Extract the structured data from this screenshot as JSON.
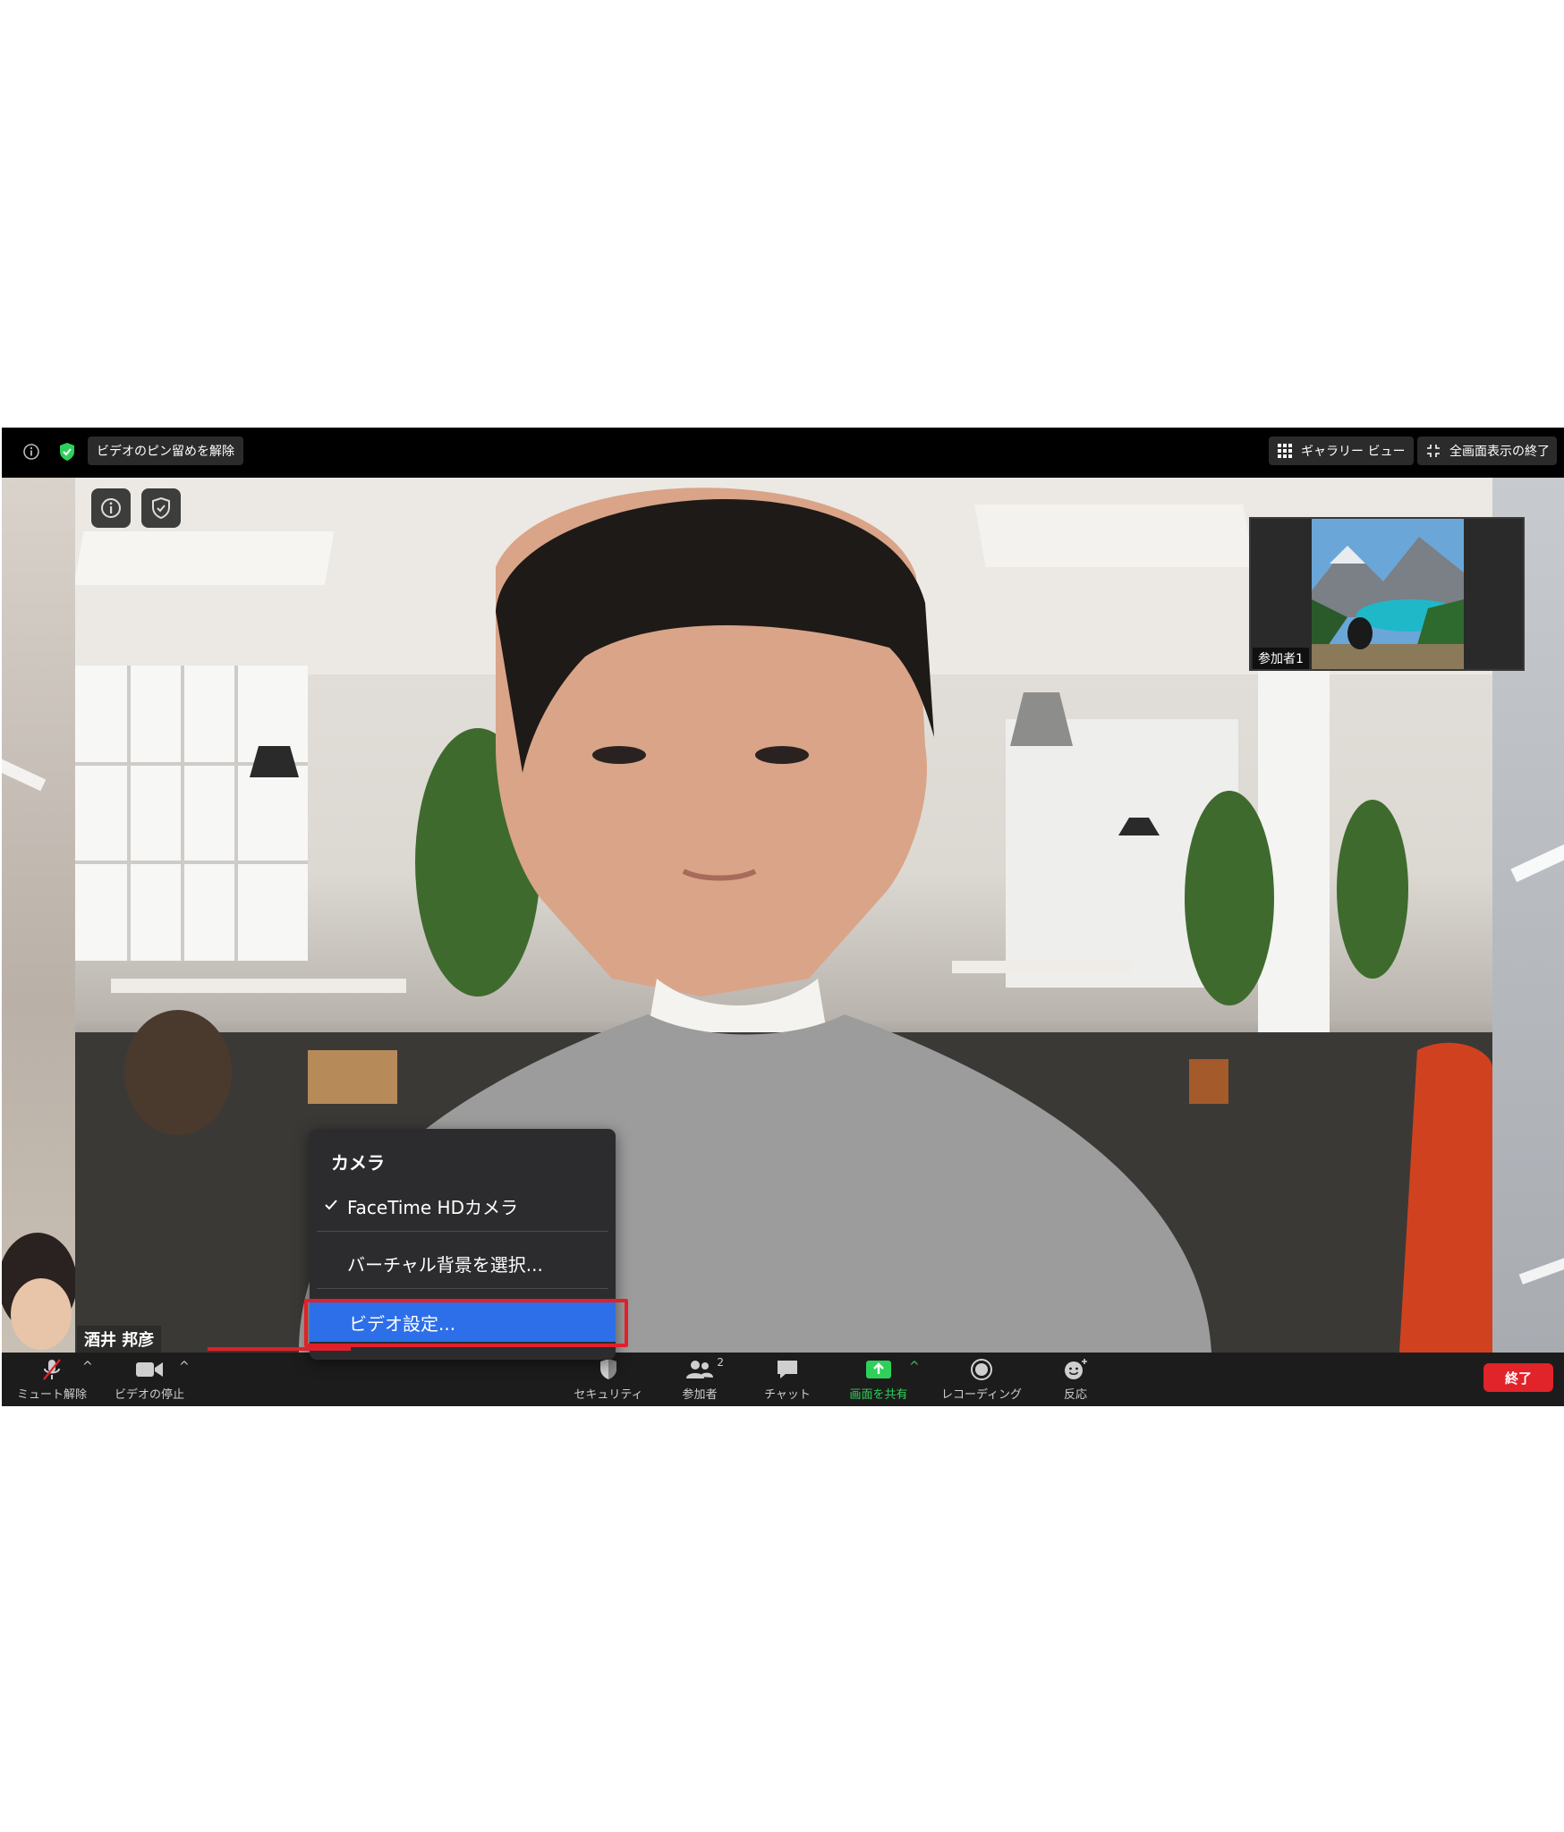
{
  "topbar": {
    "unpin_label": "ビデオのピン留めを解除",
    "gallery_label": "ギャラリー ビュー",
    "exit_fullscreen_label": "全画面表示の終了",
    "icons": [
      "info-icon",
      "shield-check-icon",
      "grid-icon",
      "compress-icon"
    ]
  },
  "video": {
    "speaker_name": "酒井 邦彦",
    "thumbnail_name": "参加者1"
  },
  "menu": {
    "title": "カメラ",
    "camera_option": "FaceTime HDカメラ",
    "virtual_background": "バーチャル背景を選択...",
    "video_settings": "ビデオ設定...",
    "selected_color": "#2d6fe8",
    "highlight_color": "#e0202a"
  },
  "toolbar": {
    "unmute": "ミュート解除",
    "stop_video": "ビデオの停止",
    "security": "セキュリティ",
    "participants": "参加者",
    "participants_count": "2",
    "chat": "チャット",
    "share_screen": "画面を共有",
    "recording": "レコーディング",
    "reactions": "反応",
    "end": "終了",
    "share_color": "#2fd05a",
    "end_color": "#e0242a"
  }
}
